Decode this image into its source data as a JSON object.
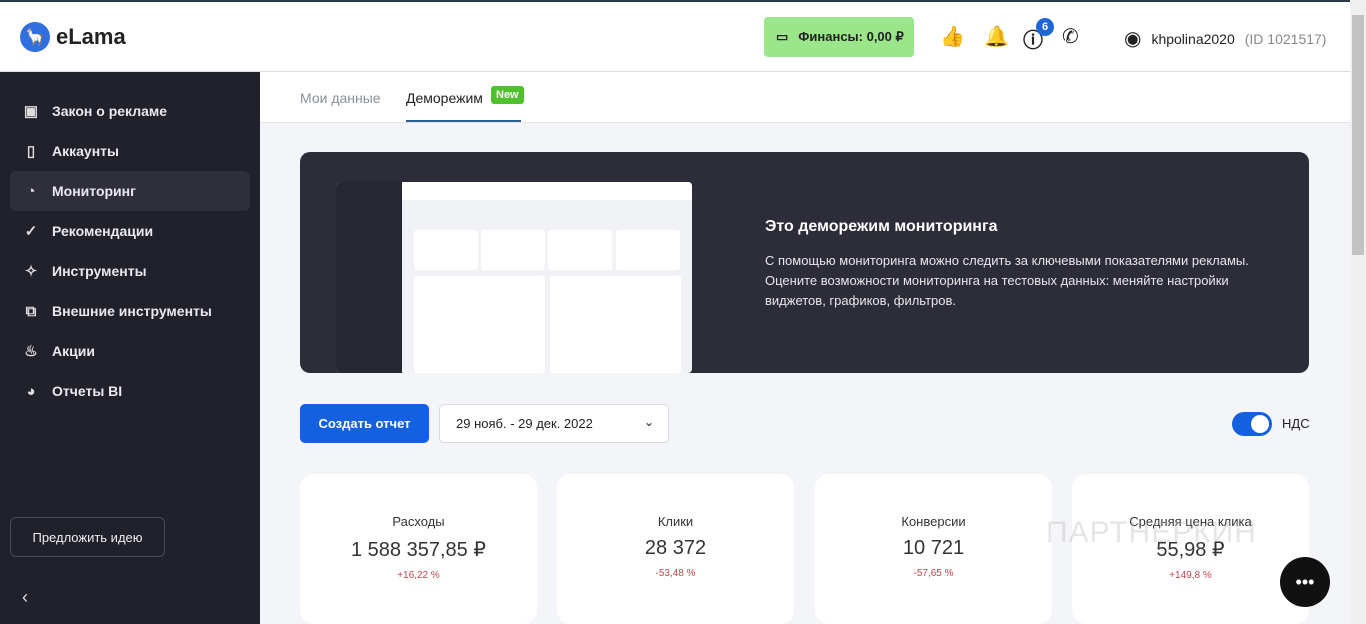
{
  "header": {
    "logo_text": "eLama",
    "finance_label": "Финансы: 0,00 ₽",
    "help_badge": "6",
    "username": "khpolina2020",
    "user_id": "(ID 1021517)",
    "watermark": "ПАРТНЕРКИН"
  },
  "sidebar": {
    "items": [
      {
        "label": "Закон о рекламе"
      },
      {
        "label": "Аккаунты"
      },
      {
        "label": "Мониторинг"
      },
      {
        "label": "Рекомендации"
      },
      {
        "label": "Инструменты"
      },
      {
        "label": "Внешние инструменты"
      },
      {
        "label": "Акции"
      },
      {
        "label": "Отчеты BI"
      }
    ],
    "idea_button": "Предложить идею"
  },
  "tabs": [
    {
      "label": "Мои данные"
    },
    {
      "label": "Деморежим"
    }
  ],
  "new_badge": "New",
  "banner": {
    "title": "Это деморежим мониторинга",
    "text": "С помощью мониторинга можно следить за ключевыми показателями рекламы. Оцените возможности мониторинга на тестовых данных: меняйте настройки виджетов, графиков, фильтров."
  },
  "controls": {
    "create_report": "Создать отчет",
    "date_range": "29 нояб. - 29 дек. 2022",
    "vat_label": "НДС",
    "vat_on": true
  },
  "kpis": [
    {
      "label": "Расходы",
      "value": "1 588 357,85 ₽",
      "change": "+16,22 %"
    },
    {
      "label": "Клики",
      "value": "28 372",
      "change": "-53,48 %"
    },
    {
      "label": "Конверсии",
      "value": "10 721",
      "change": "-57,65 %"
    },
    {
      "label": "Средняя цена клика",
      "value": "55,98 ₽",
      "change": "+149,8 %"
    }
  ]
}
